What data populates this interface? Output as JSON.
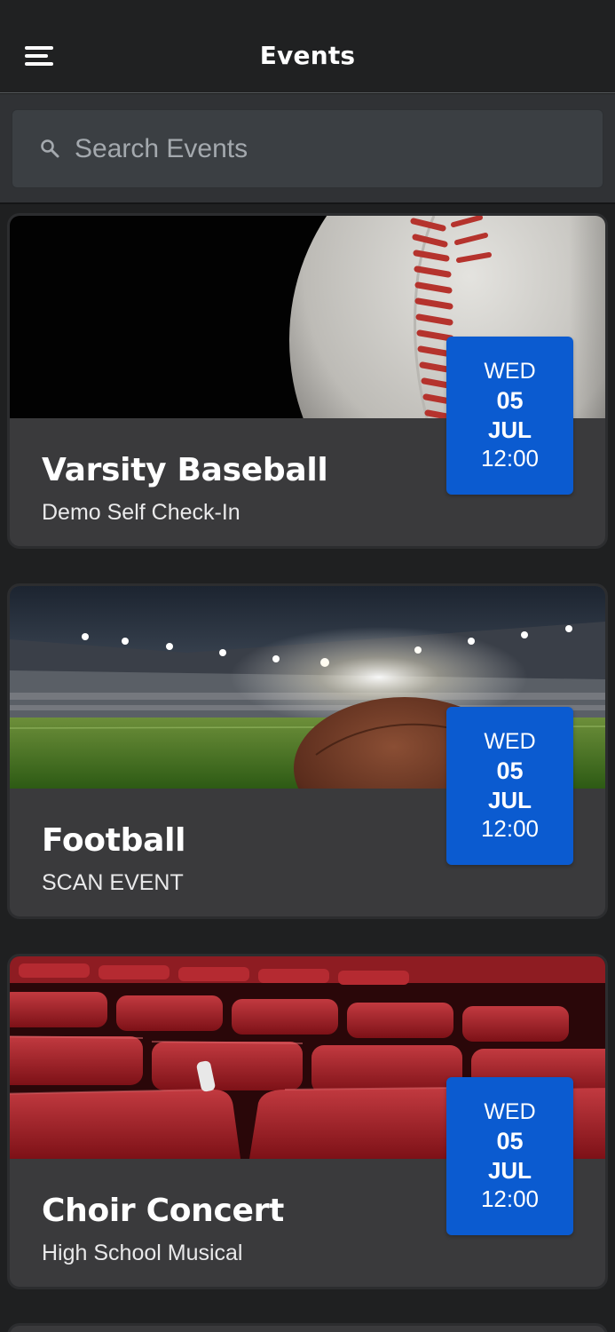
{
  "header": {
    "title": "Events",
    "menu_icon": "hamburger-menu-icon"
  },
  "search": {
    "placeholder": "Search Events",
    "value": "",
    "icon": "search-icon"
  },
  "events": [
    {
      "name": "Varsity Baseball",
      "subtitle": "Demo Self Check-In",
      "image": "baseball-photo",
      "date": {
        "dow": "WED",
        "day": "05",
        "month": "JUL",
        "time": "12:00"
      }
    },
    {
      "name": "Football",
      "subtitle": "SCAN EVENT",
      "image": "stadium-football-photo",
      "date": {
        "dow": "WED",
        "day": "05",
        "month": "JUL",
        "time": "12:00"
      }
    },
    {
      "name": "Choir Concert",
      "subtitle": "High School Musical",
      "image": "theater-seats-photo",
      "date": {
        "dow": "WED",
        "day": "05",
        "month": "JUL",
        "time": "12:00"
      }
    }
  ],
  "colors": {
    "background": "#1f2021",
    "card": "#3a3a3c",
    "date_badge": "#0b5bd0",
    "search_field": "#3b3f43"
  }
}
